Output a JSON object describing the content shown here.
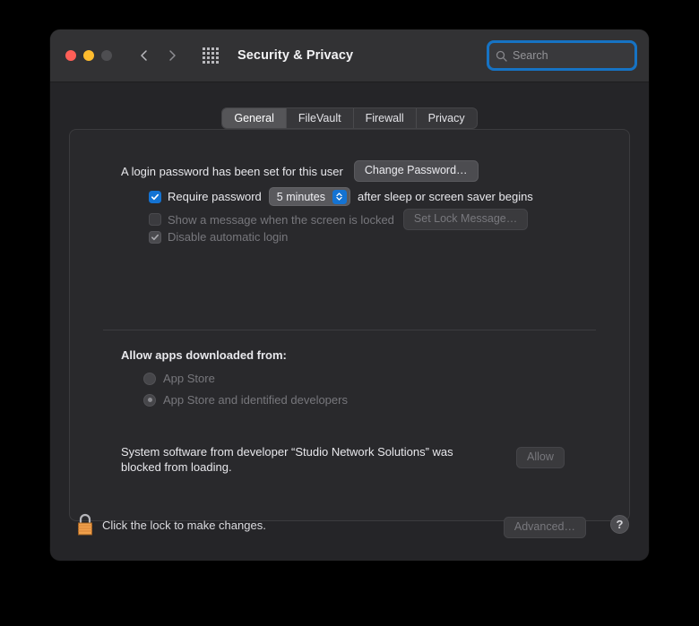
{
  "window": {
    "title": "Security & Privacy",
    "traffic_lights": [
      {
        "name": "close",
        "color": "#ff5f57"
      },
      {
        "name": "minimize",
        "color": "#febc2e"
      },
      {
        "name": "zoom",
        "color": "#4e4e51"
      }
    ],
    "nav": {
      "back_icon": "chevron-left-icon",
      "forward_icon": "chevron-right-icon"
    },
    "show_all_icon": "grid-icon"
  },
  "search": {
    "placeholder": "Search",
    "value": "",
    "icon": "search-icon",
    "focused": true,
    "focus_ring_color": "#1673c4"
  },
  "tabs": [
    {
      "label": "General",
      "active": true
    },
    {
      "label": "FileVault",
      "active": false
    },
    {
      "label": "Firewall",
      "active": false
    },
    {
      "label": "Privacy",
      "active": false
    }
  ],
  "general": {
    "password_status": "A login password has been set for this user",
    "change_password_label": "Change Password…",
    "require_password": {
      "checked": true,
      "enabled": true,
      "label": "Require password",
      "delay_value": "5 minutes",
      "trailing_label": "after sleep or screen saver begins",
      "stepper_icon": "chevron-up-down-icon",
      "accent_color": "#1473d3"
    },
    "show_message": {
      "checked": false,
      "enabled": false,
      "label": "Show a message when the screen is locked",
      "button_label": "Set Lock Message…"
    },
    "disable_auto_login": {
      "checked": true,
      "enabled": false,
      "label": "Disable automatic login"
    },
    "allow_apps_title": "Allow apps downloaded from:",
    "allow_apps_options": [
      {
        "label": "App Store",
        "selected": false,
        "enabled": false
      },
      {
        "label": "App Store and identified developers",
        "selected": true,
        "enabled": false
      }
    ],
    "blocked_notice": "System software from developer “Studio Network Solutions” was blocked from loading.",
    "allow_button_label": "Allow",
    "allow_button_enabled": false
  },
  "footer": {
    "lock_icon": "lock-closed-icon",
    "lock_color": "#f0a04b",
    "lock_message": "Click the lock to make changes.",
    "advanced_label": "Advanced…",
    "advanced_enabled": false,
    "help_label": "?"
  }
}
